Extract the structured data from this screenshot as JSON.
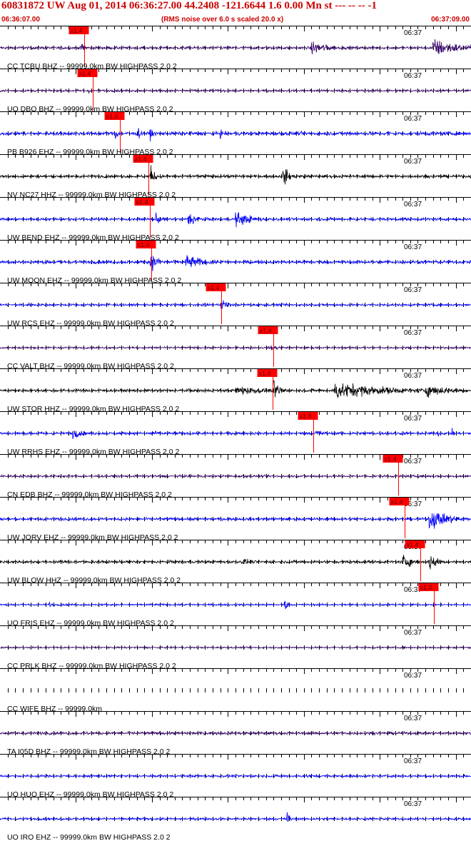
{
  "header": {
    "title": "60831872 UW Aug 01, 2014 06:36:27.00    44.2408 -121.6644  1.6 0.00 Mn st --- -- --   -1",
    "start_time": "06:36:07.00",
    "subtitle": "(RMS noise over 6.0 s scaled 20.0 x)",
    "end_time": "06:37:09.00"
  },
  "colors": {
    "header_text": "#cc0000",
    "pick_marker": "#ff0000",
    "blue_trace": "#0000ff",
    "black_trace": "#000000",
    "purple_trace": "#330066",
    "grid": "#000000"
  },
  "chart_data": {
    "type": "line",
    "description_type": "seismogram-record-section",
    "x_range_seconds": [
      0,
      62
    ],
    "time_tick_label": "06:37",
    "pick_label": "x1.4",
    "traces": [
      {
        "label": "CC TCBU BHZ -- 99999.0km BW  HIGHPASS  2.0  2",
        "color": "purple",
        "pick_s": 11.1,
        "amp": 0.12,
        "events": [
          [
            10.7,
            0.5,
            0.8
          ],
          [
            41.0,
            0.7,
            2.2
          ],
          [
            57.0,
            0.9,
            3.5
          ]
        ]
      },
      {
        "label": "UO DBO BHZ -- 99999.0km BW  HIGHPASS  2.0  2",
        "color": "purple",
        "pick_s": 12.2,
        "amp": 0.1,
        "events": [
          [
            11.5,
            0.25,
            1.0
          ]
        ]
      },
      {
        "label": "PB B926 EHZ -- 99999.0km BW  HIGHPASS  2.0  2",
        "color": "blue",
        "pick_s": 15.8,
        "amp": 0.16,
        "events": [
          [
            15.2,
            0.9,
            0.3
          ],
          [
            18.2,
            0.6,
            0.4
          ],
          [
            19.8,
            0.6,
            0.4
          ],
          [
            29.0,
            0.5,
            0.3
          ],
          [
            45.5,
            0.4,
            0.4
          ],
          [
            51.0,
            0.4,
            0.4
          ]
        ]
      },
      {
        "label": "NV NC27 HHZ -- 99999.0km BW  HIGHPASS  2.0  2",
        "color": "black",
        "pick_s": 19.5,
        "amp": 0.12,
        "events": [
          [
            19.8,
            1.0,
            0.6
          ],
          [
            23.5,
            0.3,
            0.6
          ],
          [
            37.3,
            1.0,
            0.8
          ],
          [
            40.0,
            0.3,
            0.5
          ]
        ]
      },
      {
        "label": "UW BEND EHZ -- 99999.0km BW  HIGHPASS  2.0  2",
        "color": "blue",
        "pick_s": 19.7,
        "amp": 0.12,
        "events": [
          [
            20.5,
            0.5,
            1.0
          ],
          [
            24.8,
            0.8,
            1.2
          ],
          [
            31.0,
            0.7,
            2.5
          ]
        ]
      },
      {
        "label": "UW MOON EHZ -- 99999.0km BW  HIGHPASS  2.0  2",
        "color": "blue",
        "pick_s": 19.9,
        "amp": 0.14,
        "events": [
          [
            19.8,
            0.9,
            1.2
          ],
          [
            24.5,
            0.7,
            2.5
          ]
        ]
      },
      {
        "label": "UW RCS EHZ -- 99999.0km BW  HIGHPASS  2.0  2",
        "color": "blue",
        "pick_s": 29.1,
        "amp": 0.1,
        "events": [
          [
            3.5,
            0.3,
            0.5
          ],
          [
            14.0,
            0.35,
            0.5
          ],
          [
            29.2,
            0.8,
            0.7
          ]
        ]
      },
      {
        "label": "CC VALT BHZ -- 99999.0km BW  HIGHPASS  2.0  2",
        "color": "purple",
        "pick_s": 36.0,
        "amp": 0.08,
        "events": [
          [
            35.5,
            0.3,
            1.5
          ]
        ]
      },
      {
        "label": "UW STOR HHZ -- 99999.0km BW  HIGHPASS  2.0  2",
        "color": "black",
        "pick_s": 35.9,
        "amp": 0.12,
        "events": [
          [
            31.0,
            0.5,
            4.0
          ],
          [
            36.0,
            1.0,
            1.0
          ],
          [
            44.0,
            0.85,
            7.0
          ],
          [
            56.0,
            0.6,
            4.0
          ]
        ]
      },
      {
        "label": "UW RRHS EHZ -- 99999.0km BW  HIGHPASS  2.0  2",
        "color": "blue",
        "pick_s": 41.2,
        "amp": 0.12,
        "events": [
          [
            9.5,
            0.55,
            1.3
          ],
          [
            20.0,
            0.45,
            0.6
          ],
          [
            41.5,
            0.45,
            1.2
          ],
          [
            57.5,
            0.45,
            0.5
          ],
          [
            59.5,
            0.4,
            0.5
          ]
        ]
      },
      {
        "label": "CN EDB BHZ -- 99999.0km BW  HIGHPASS  2.0  2",
        "color": "purple",
        "pick_s": 52.4,
        "amp": 0.1,
        "events": []
      },
      {
        "label": "UW JORV EHZ -- 99999.0km BW  HIGHPASS  2.0  2",
        "color": "blue",
        "pick_s": 53.3,
        "amp": 0.12,
        "events": [
          [
            56.5,
            1.0,
            2.8
          ]
        ]
      },
      {
        "label": "UW BLOW HHZ -- 99999.0km BW  HIGHPASS  2.0  2",
        "color": "black",
        "pick_s": 55.3,
        "amp": 0.12,
        "events": [
          [
            25.0,
            0.3,
            0.3
          ],
          [
            32.0,
            0.35,
            1.5
          ],
          [
            53.0,
            0.7,
            1.5
          ],
          [
            56.5,
            1.0,
            1.0
          ]
        ]
      },
      {
        "label": "UO FRIS EHZ -- 99999.0km BW  HIGHPASS  2.0  2",
        "color": "blue",
        "pick_s": 57.1,
        "amp": 0.08,
        "events": [
          [
            6.5,
            0.3,
            0.3
          ],
          [
            37.5,
            0.6,
            0.4
          ]
        ]
      },
      {
        "label": "CC PRLK BHZ -- 99999.0km BW  HIGHPASS  2.0  2",
        "color": "purple",
        "pick_s": null,
        "amp": 0.07,
        "events": []
      },
      {
        "label": "CC WIFE BHZ -- 99999.0km",
        "color": "purple",
        "pick_s": null,
        "amp": 0.0,
        "events": []
      },
      {
        "label": "TA I05D BHZ -- 99999.0km BW  HIGHPASS  2.0  2",
        "color": "purple",
        "pick_s": null,
        "amp": 0.12,
        "events": []
      },
      {
        "label": "UO HUO EHZ -- 99999.0km BW  HIGHPASS  2.0  2",
        "color": "blue",
        "pick_s": null,
        "amp": 0.1,
        "events": [
          [
            40.0,
            0.2,
            3.0
          ]
        ]
      },
      {
        "label": "UO IRO EHZ -- 99999.0km BW  HIGHPASS  2.0  2",
        "color": "blue",
        "pick_s": null,
        "amp": 0.1,
        "events": [
          [
            37.8,
            1.0,
            0.3
          ]
        ]
      }
    ]
  }
}
